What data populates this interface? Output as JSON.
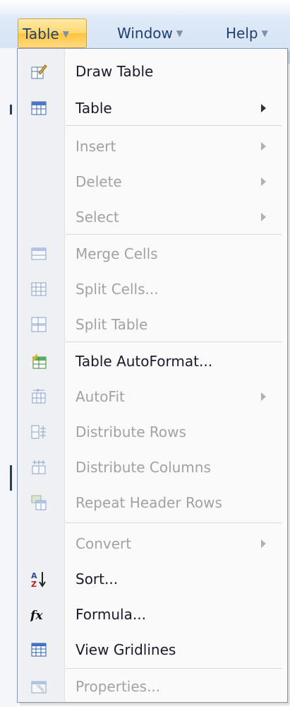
{
  "menubar": {
    "menus": [
      {
        "label": "Table"
      },
      {
        "label": "Window"
      },
      {
        "label": "Help"
      }
    ]
  },
  "dropdown": {
    "items": [
      {
        "label": "Draw Table",
        "icon": "pencil-table-icon",
        "enabled": true,
        "submenu": false
      },
      {
        "label": "Table",
        "icon": "table-icon",
        "enabled": true,
        "submenu": true
      },
      {
        "label": "Insert",
        "icon": "",
        "enabled": false,
        "submenu": true
      },
      {
        "label": "Delete",
        "icon": "",
        "enabled": false,
        "submenu": true
      },
      {
        "label": "Select",
        "icon": "",
        "enabled": false,
        "submenu": true
      },
      {
        "label": "Merge Cells",
        "icon": "merge-cells-icon",
        "enabled": false,
        "submenu": false
      },
      {
        "label": "Split Cells...",
        "icon": "split-cells-icon",
        "enabled": false,
        "submenu": false
      },
      {
        "label": "Split Table",
        "icon": "split-table-icon",
        "enabled": false,
        "submenu": false
      },
      {
        "label": "Table AutoFormat...",
        "icon": "autoformat-icon",
        "enabled": true,
        "submenu": false
      },
      {
        "label": "AutoFit",
        "icon": "autofit-icon",
        "enabled": false,
        "submenu": true
      },
      {
        "label": "Distribute Rows",
        "icon": "distribute-rows-icon",
        "enabled": false,
        "submenu": false
      },
      {
        "label": "Distribute Columns",
        "icon": "distribute-columns-icon",
        "enabled": false,
        "submenu": false
      },
      {
        "label": "Repeat Header Rows",
        "icon": "repeat-header-icon",
        "enabled": false,
        "submenu": false
      },
      {
        "label": "Convert",
        "icon": "",
        "enabled": false,
        "submenu": true
      },
      {
        "label": "Sort...",
        "icon": "sort-az-icon",
        "enabled": true,
        "submenu": false
      },
      {
        "label": "Formula...",
        "icon": "formula-fx-icon",
        "enabled": true,
        "submenu": false
      },
      {
        "label": "View Gridlines",
        "icon": "gridlines-icon",
        "enabled": true,
        "submenu": false
      },
      {
        "label": "Properties...",
        "icon": "properties-icon",
        "enabled": false,
        "submenu": false
      }
    ]
  }
}
